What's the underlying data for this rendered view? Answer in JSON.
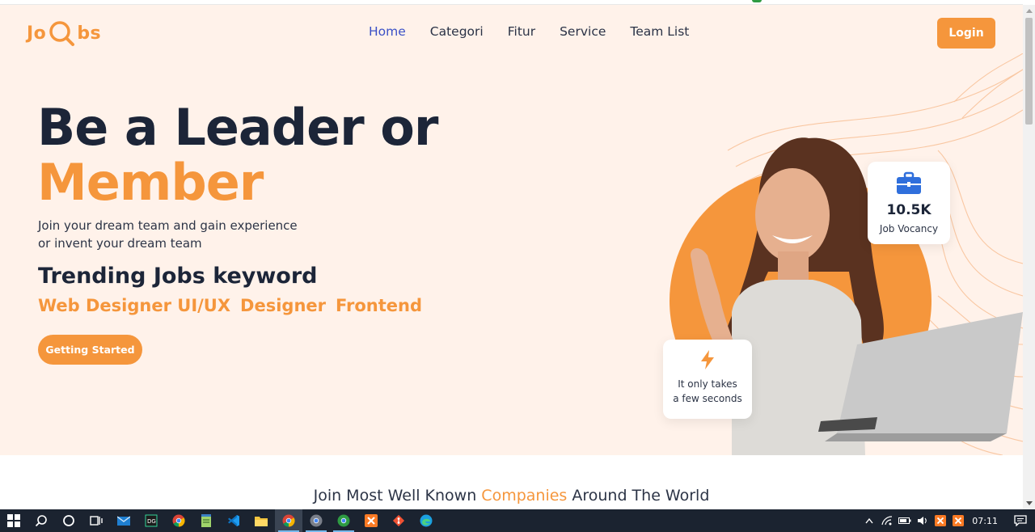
{
  "brand": {
    "logo_left": "Jo",
    "logo_right": "bs",
    "accent": "#f5963c",
    "dark": "#1c2538",
    "link_active": "#3a50c6"
  },
  "nav": {
    "items": [
      {
        "label": "Home",
        "active": true
      },
      {
        "label": "Categori"
      },
      {
        "label": "Fitur"
      },
      {
        "label": "Service"
      },
      {
        "label": "Team List"
      }
    ],
    "login_label": "Login"
  },
  "hero": {
    "title_line1": "Be a Leader or",
    "title_line2": "Member",
    "subtitle_line1": "Join your dream team and gain experience",
    "subtitle_line2": "or invent your dream team",
    "trending_title": "Trending Jobs keyword",
    "keywords": [
      "Web Designer UI/UX",
      "Designer",
      "Frontend"
    ],
    "cta_label": "Getting Started"
  },
  "stats": {
    "jobs_value": "10.5K",
    "jobs_label": "Job Vocancy",
    "fast_line1": "It only takes",
    "fast_line2": "a few seconds",
    "jobs_icon": "briefcase-icon",
    "fast_icon": "lightning-icon"
  },
  "companies": {
    "before": "Join Most Well Known ",
    "highlight": "Companies",
    "after": " Around The World"
  },
  "taskbar": {
    "apps": [
      "windows-start-icon",
      "search-icon",
      "cortana-icon",
      "task-view-icon",
      "mail-icon",
      "datagrip-icon",
      "chrome-icon",
      "notepad-icon",
      "vscode-icon",
      "file-explorer-icon",
      "chrome-icon",
      "chrome-icon",
      "chrome-icon",
      "xampp-icon",
      "git-icon",
      "edge-icon"
    ],
    "time": "07:11"
  }
}
